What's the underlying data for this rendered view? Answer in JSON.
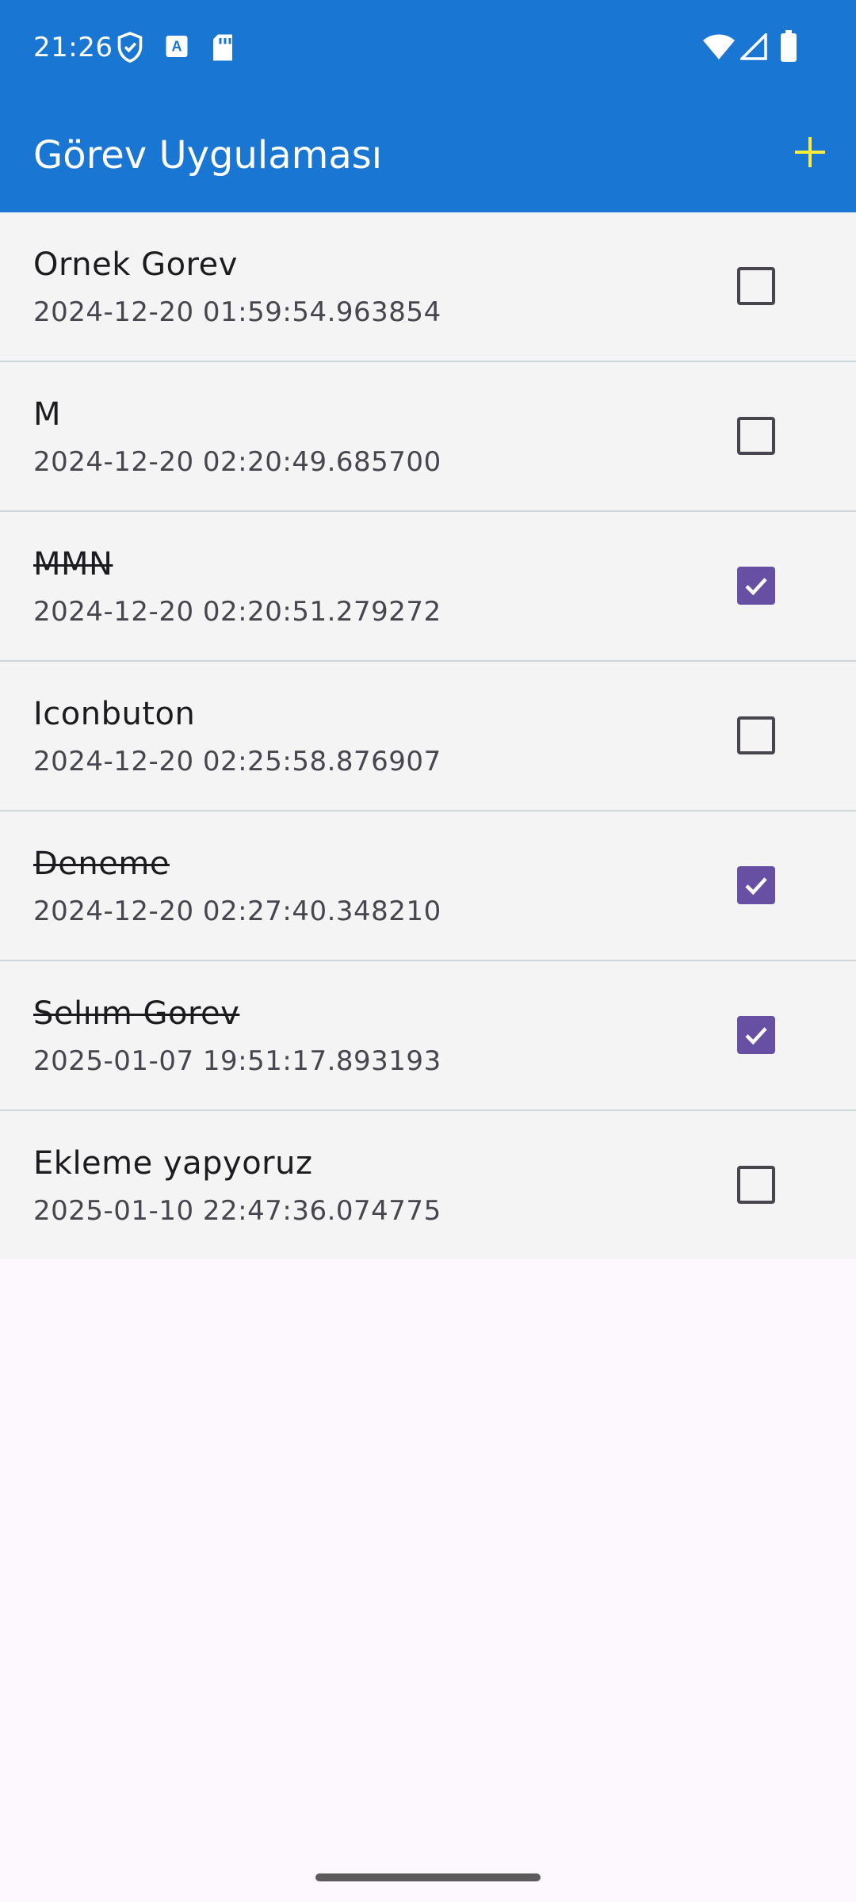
{
  "status_bar": {
    "time": "21:26",
    "left_icons": [
      "shield-icon",
      "translate-icon",
      "sd-card-icon"
    ],
    "right_icons": [
      "wifi-icon",
      "signal-icon",
      "battery-icon"
    ]
  },
  "app_bar": {
    "title": "Görev Uygulaması",
    "add_icon": "plus-icon",
    "accent_color": "#ffeb3b",
    "background_color": "#1976d2"
  },
  "tasks": [
    {
      "title": "Ornek Gorev",
      "date": "2024-12-20 01:59:54.963854",
      "done": false
    },
    {
      "title": "M",
      "date": "2024-12-20 02:20:49.685700",
      "done": false
    },
    {
      "title": "MMN",
      "date": "2024-12-20 02:20:51.279272",
      "done": true
    },
    {
      "title": "Iconbuton",
      "date": "2024-12-20 02:25:58.876907",
      "done": false
    },
    {
      "title": "Deneme",
      "date": "2024-12-20 02:27:40.348210",
      "done": true
    },
    {
      "title": "Selıım Gorev",
      "date": "2025-01-07 19:51:17.893193",
      "done": true
    },
    {
      "title": "Ekleme yapyoruz",
      "date": "2025-01-10 22:47:36.074775",
      "done": false
    }
  ],
  "colors": {
    "checkbox_checked": "#6750a4",
    "list_background": "#f4f4f4",
    "page_background": "#fdf7fe"
  }
}
